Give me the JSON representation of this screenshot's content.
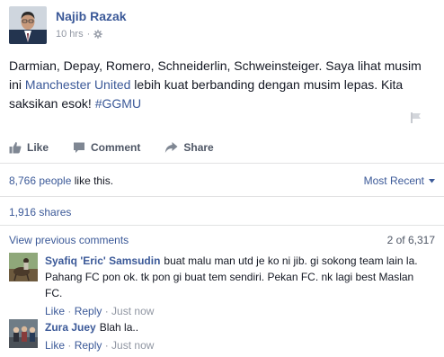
{
  "post": {
    "author": "Najib Razak",
    "time": "10 hrs",
    "text_parts": {
      "p1": "Darmian, Depay, Romero, Schneiderlin, Schweinsteiger. Saya lihat musim ini ",
      "link": "Manchester United",
      "p2": " lebih kuat berbanding dengan musim lepas. Kita saksikan esok! ",
      "hashtag": "#GGMU"
    }
  },
  "actions": {
    "like": "Like",
    "comment": "Comment",
    "share": "Share"
  },
  "stats": {
    "likes_count": "8,766 people",
    "likes_suffix": " like this.",
    "sort": "Most Recent",
    "shares": "1,916 shares"
  },
  "comments_section": {
    "view_previous": "View previous comments",
    "count": "2 of 6,317",
    "items": [
      {
        "name": "Syafiq 'Eric' Samsudin",
        "text": "buat malu man utd je ko ni jib. gi sokong team lain la. Pahang FC pon ok. tk pon gi buat tem sendiri. Pekan FC. nk lagi best Maslan FC.",
        "like": "Like",
        "reply": "Reply",
        "time": "Just now"
      },
      {
        "name": "Zura Juey",
        "text": "Blah la..",
        "like": "Like",
        "reply": "Reply",
        "time": "Just now"
      }
    ]
  },
  "colors": {
    "link": "#3b5998",
    "text": "#141823",
    "muted": "#9197a3",
    "divider": "#e1e2e3"
  },
  "icons": {
    "privacy": "gear-icon",
    "like": "thumbs-up-icon",
    "comment": "speech-bubble-icon",
    "share": "share-arrow-icon",
    "report": "flag-icon",
    "sort": "chevron-down-icon"
  }
}
